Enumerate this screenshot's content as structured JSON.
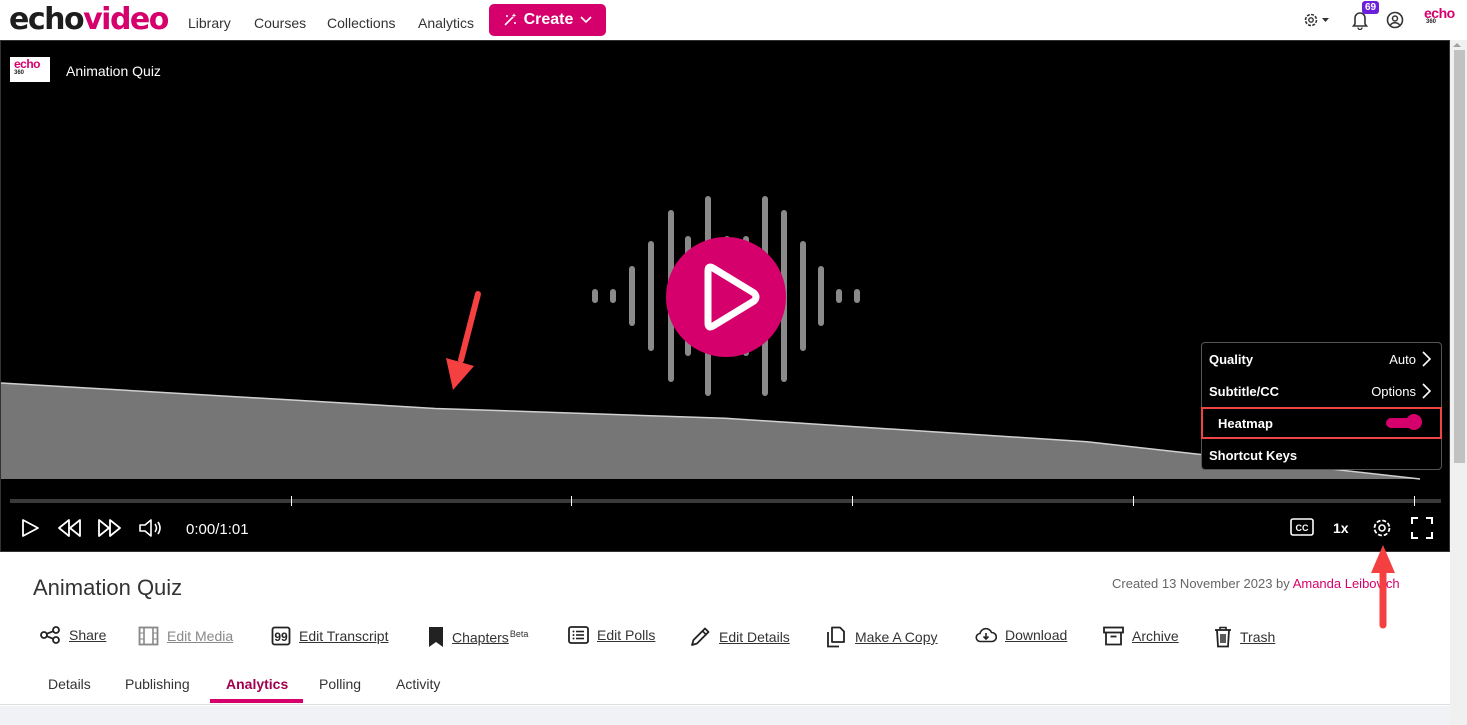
{
  "app": {
    "logo_part1": "echo",
    "logo_part2": "video",
    "brand_color": "#d6006d"
  },
  "nav": {
    "links": [
      "Library",
      "Courses",
      "Collections",
      "Analytics"
    ],
    "create_label": "Create",
    "notification_count": "69",
    "brand_mark_top": "echo",
    "brand_mark_bottom": "360"
  },
  "player": {
    "logo_top": "echo",
    "logo_bottom": "360",
    "title": "Animation Quiz",
    "current_time": "0:00",
    "duration": "1:01",
    "time_display": "0:00/1:01",
    "speed": "1x",
    "progress_fraction": 0,
    "heatmap": {
      "description": "Viewer retention curve, decreasing over time",
      "points": [
        [
          0,
          0.98
        ],
        [
          0.3,
          0.72
        ],
        [
          0.5,
          0.62
        ],
        [
          0.75,
          0.38
        ],
        [
          0.98,
          0.0
        ]
      ]
    },
    "settings_menu": {
      "quality_label": "Quality",
      "quality_value": "Auto",
      "subtitle_label": "Subtitle/CC",
      "subtitle_value": "Options",
      "heatmap_label": "Heatmap",
      "heatmap_enabled": true,
      "shortcut_label": "Shortcut Keys"
    }
  },
  "details": {
    "title": "Animation Quiz",
    "created_prefix": "Created 13 November 2023 by",
    "author": "Amanda Leibovich",
    "actions": [
      {
        "label": "Share",
        "icon": "share-icon",
        "enabled": true
      },
      {
        "label": "Edit Media",
        "icon": "film-icon",
        "enabled": false
      },
      {
        "label": "Edit Transcript",
        "icon": "quote-icon",
        "enabled": true
      },
      {
        "label": "Chapters",
        "superscript": "Beta",
        "icon": "bookmark-icon",
        "enabled": true
      },
      {
        "label": "Edit Polls",
        "icon": "list-icon",
        "enabled": true
      },
      {
        "label": "Edit Details",
        "icon": "pencil-icon",
        "enabled": true
      },
      {
        "label": "Make A Copy",
        "icon": "copy-icon",
        "enabled": true
      },
      {
        "label": "Download",
        "icon": "cloud-download-icon",
        "enabled": true
      },
      {
        "label": "Archive",
        "icon": "archive-icon",
        "enabled": true
      },
      {
        "label": "Trash",
        "icon": "trash-icon",
        "enabled": true
      }
    ]
  },
  "tabs": {
    "items": [
      "Details",
      "Publishing",
      "Analytics",
      "Polling",
      "Activity"
    ],
    "active": "Analytics"
  }
}
